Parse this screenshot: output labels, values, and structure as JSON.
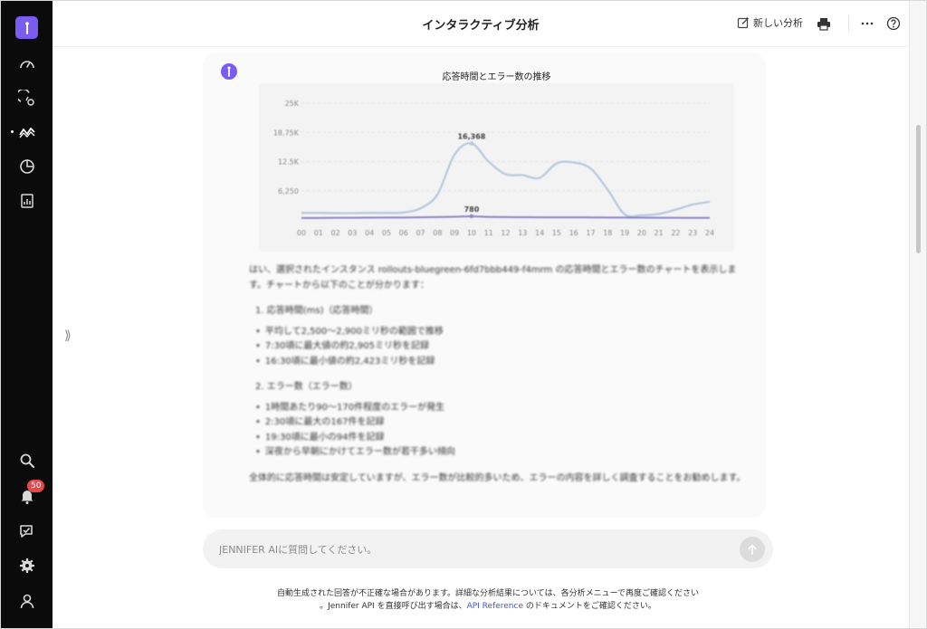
{
  "sidebar": {
    "logo": "jennifer-logo",
    "items": [
      {
        "name": "dashboard-gauge-icon"
      },
      {
        "name": "gauge-settings-icon"
      },
      {
        "name": "analysis-wave-icon",
        "active": true
      },
      {
        "name": "pie-chart-icon"
      },
      {
        "name": "report-chart-icon"
      }
    ],
    "bottom": [
      {
        "name": "search-icon"
      },
      {
        "name": "bell-icon",
        "badge": "50"
      },
      {
        "name": "chat-check-icon"
      },
      {
        "name": "gear-icon"
      },
      {
        "name": "user-icon"
      }
    ]
  },
  "header": {
    "title": "インタラクティブ分析",
    "new_analysis": "新しい分析",
    "icons": [
      "edit-icon",
      "print-icon",
      "more-icon",
      "help-icon"
    ]
  },
  "chat": {
    "expand_glyph": "⟫",
    "chart_title": "応答時間とエラー数の推移",
    "message": {
      "intro": "はい、選択されたインスタンス rollouts-bluegreen-6fd7bbb449-f4mrm の応答時間とエラー数のチャートを表示します。チャートから以下のことが分かります：",
      "section1": "1. 応答時間(ms)（応答時間）",
      "section1_items": [
        "平均して2,500～2,900ミリ秒の範囲で推移",
        "7:30頃に最大値の約2,905ミリ秒を記録",
        "16:30頃に最小値の約2,423ミリ秒を記録"
      ],
      "section2": "2. エラー数（エラー数）",
      "section2_items": [
        "1時間あたり90～170件程度のエラーが発生",
        "2:30頃に最大の167件を記録",
        "19:30頃に最小の94件を記録",
        "深夜から早朝にかけてエラー数が若干多い傾向"
      ],
      "summary": "全体的に応答時間は安定していますが、エラー数が比較的多いため、エラーの内容を詳しく調査することをお勧めします。"
    }
  },
  "input": {
    "placeholder": "JENNIFER AIに質問してください。"
  },
  "footer": {
    "line1": "自動生成された回答が不正確な場合があります。詳細な分析結果については、各分析メニューで再度ご確認ください",
    "line2_prefix": "。Jennifer API を直接呼び出す場合は、",
    "line2_link": "API Reference",
    "line2_suffix": " のドキュメントをご確認ください。"
  },
  "colors": {
    "accent": "#7b5cf0",
    "sidebar_bg": "#0b0b0b",
    "series1": "#b7c9dc",
    "series2": "#8a86c4",
    "badge": "#e5484d",
    "link": "#3a5ad9"
  },
  "chart_data": {
    "type": "line",
    "title": "応答時間とエラー数の推移",
    "categories": [
      "00",
      "01",
      "02",
      "03",
      "04",
      "05",
      "06",
      "07",
      "08",
      "09",
      "10",
      "11",
      "12",
      "13",
      "14",
      "15",
      "16",
      "17",
      "18",
      "19",
      "20",
      "21",
      "22",
      "23",
      "24"
    ],
    "y_ticks": [
      "6,250",
      "12.5K",
      "18.75K",
      "25K"
    ],
    "ylim": [
      0,
      25000
    ],
    "series": [
      {
        "values": [
          1500,
          1500,
          1450,
          1450,
          1500,
          1500,
          1600,
          2500,
          5500,
          14000,
          16368,
          12500,
          9800,
          9600,
          9000,
          12100,
          12300,
          11000,
          6500,
          1200,
          1000,
          1300,
          2200,
          3300,
          3900
        ]
      },
      {
        "values": [
          400,
          420,
          450,
          460,
          480,
          500,
          520,
          560,
          600,
          680,
          780,
          650,
          600,
          580,
          560,
          560,
          560,
          540,
          520,
          500,
          480,
          460,
          450,
          440,
          430
        ]
      }
    ],
    "annotations": [
      {
        "x": "10",
        "value": 16368,
        "label": "16,368"
      },
      {
        "x": "10",
        "value": 780,
        "label": "780"
      }
    ],
    "grid": "horizontal dashed",
    "legend": "none"
  }
}
